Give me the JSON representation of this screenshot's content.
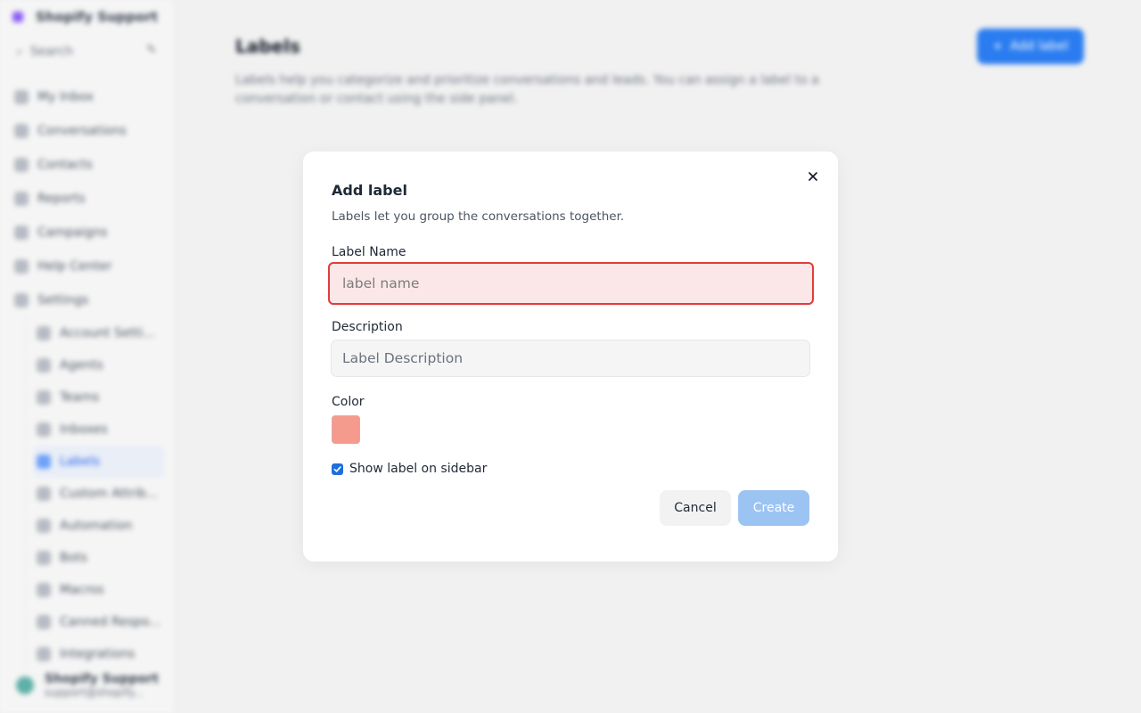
{
  "sidebar": {
    "workspace": "Shopify Support",
    "search_label": "Search",
    "items": [
      {
        "label": "My Inbox",
        "icon": "inbox-icon"
      },
      {
        "label": "Conversations",
        "icon": "chat-icon"
      },
      {
        "label": "Contacts",
        "icon": "contacts-icon"
      },
      {
        "label": "Reports",
        "icon": "reports-icon"
      },
      {
        "label": "Campaigns",
        "icon": "megaphone-icon"
      },
      {
        "label": "Help Center",
        "icon": "book-icon"
      },
      {
        "label": "Settings",
        "icon": "gear-icon"
      }
    ],
    "settings_items": [
      {
        "label": "Account Setti..."
      },
      {
        "label": "Agents"
      },
      {
        "label": "Teams"
      },
      {
        "label": "Inboxes"
      },
      {
        "label": "Labels"
      },
      {
        "label": "Custom Attrib..."
      },
      {
        "label": "Automation"
      },
      {
        "label": "Bots"
      },
      {
        "label": "Macros"
      },
      {
        "label": "Canned Respo..."
      },
      {
        "label": "Integrations"
      }
    ],
    "footer_name": "Shopify Support",
    "footer_sub": "support@shopify..."
  },
  "page": {
    "title": "Labels",
    "description": "Labels help you categorize and prioritize conversations and leads. You can assign a label to a conversation or contact using the side panel.",
    "add_button": "Add label"
  },
  "modal": {
    "title": "Add label",
    "subtitle": "Labels let you group the conversations together.",
    "name_label": "Label Name",
    "name_placeholder": "label name",
    "description_label": "Description",
    "description_placeholder": "Label Description",
    "color_label": "Color",
    "color_value": "#F59A8C",
    "show_on_sidebar_label": "Show label on sidebar",
    "show_on_sidebar_checked": true,
    "cancel_label": "Cancel",
    "create_label": "Create"
  }
}
